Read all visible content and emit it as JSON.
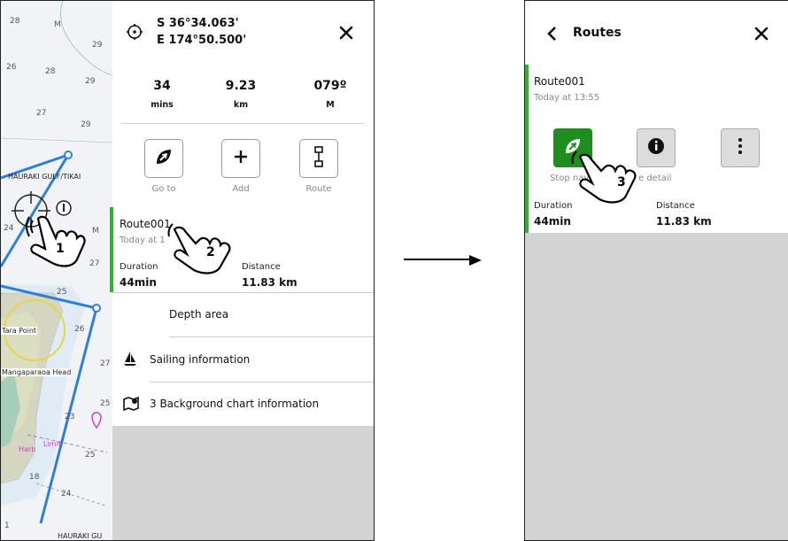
{
  "left": {
    "chart": {
      "depths": [
        "28",
        "M",
        "29",
        "26",
        "28",
        "29",
        "27",
        "29",
        "24",
        "M",
        "27",
        "25",
        "26",
        "27",
        "25",
        "23",
        "25",
        "18",
        "24",
        "1"
      ],
      "places": [
        "HAURAKI GULF/TIKAI",
        "Tara Point",
        "Mangaparaoa Head",
        "HAURAKI GU",
        "Harb",
        "Limit"
      ]
    },
    "header": {
      "lat": "S 36°34.063'",
      "lon": "E 174°50.500'",
      "close_icon": "close-icon"
    },
    "stats": [
      {
        "value": "34",
        "unit": "mins"
      },
      {
        "value": "9.23",
        "unit": "km"
      },
      {
        "value": "079º",
        "unit": "M"
      }
    ],
    "actions": [
      {
        "label": "Go to",
        "icon": "leaf-nav-icon"
      },
      {
        "label": "Add",
        "icon": "plus-icon"
      },
      {
        "label": "Route",
        "icon": "route-icon"
      }
    ],
    "route": {
      "name": "Route001",
      "time": "Today at 1",
      "duration_label": "Duration",
      "duration_value": "44min",
      "distance_label": "Distance",
      "distance_value": "11.83 km"
    },
    "menu": [
      {
        "label": "Depth area",
        "icon": ""
      },
      {
        "label": "Sailing information",
        "icon": "sailboat-icon"
      },
      {
        "label": "3 Background chart information",
        "icon": "chart-info-icon"
      }
    ]
  },
  "right": {
    "header": {
      "title": "Routes",
      "back_icon": "chevron-left-icon",
      "close_icon": "close-icon"
    },
    "route": {
      "name": "Route001",
      "time": "Today at 13:55",
      "btn_stop_label": "Stop nav",
      "btn_detail_label": "e detail",
      "duration_label": "Duration",
      "duration_value": "44min",
      "distance_label": "Distance",
      "distance_value": "11.83 km"
    }
  },
  "steps": [
    "1",
    "2",
    "3"
  ],
  "colors": {
    "accent_green": "#2db52d",
    "button_green": "#1e8f1e",
    "route_blue": "#2f7fd8",
    "panel_grey": "#d3d3d3"
  }
}
